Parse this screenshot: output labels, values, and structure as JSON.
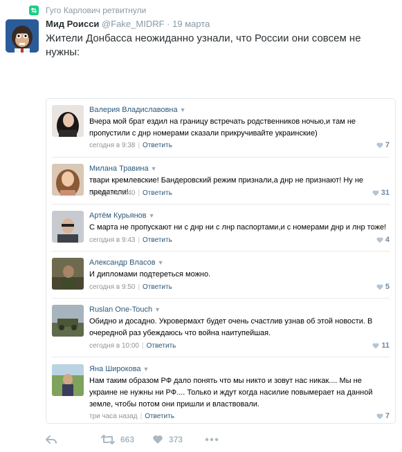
{
  "retweet": {
    "text": "Гуго Карлович ретвитнули"
  },
  "tweet": {
    "name": "Мид Роисси",
    "handle": "@Fake_MIDRF",
    "dot": "·",
    "date": "19 марта",
    "text": "Жители Донбасса неожиданно узнали, что России они совсем не нужны:"
  },
  "comments": [
    {
      "name": "Валерия Владиславовна",
      "text": "Вчера мой брат ездил на границу встречать родственников ночью,и там не пропустили с днр номерами сказали прикручивайте украинские)",
      "time": "сегодня в 9:38",
      "reply": "Ответить",
      "likes": "7"
    },
    {
      "name": "Милана Травина",
      "text": "твари кремлевские! Бандеровский режим признали,а днр не признают! Ну не предатели!",
      "time": "сегодня в 9:40",
      "reply": "Ответить",
      "likes": "31"
    },
    {
      "name": "Артём Курьянов",
      "text": "С марта не пропускают ни с днр ни с лнр паспортами,и с номерами днр и лнр тоже!",
      "time": "сегодня в 9:43",
      "reply": "Ответить",
      "likes": "4"
    },
    {
      "name": "Александр Власов",
      "text": "И дипломами подтереться можно.",
      "time": "сегодня в 9:50",
      "reply": "Ответить",
      "likes": "5"
    },
    {
      "name": "Ruslan One-Touch",
      "text": "Обидно и досадно. Укровермахт будет очень счастлив узнав об этой новости. В очередной раз убеждаюсь что война наитупейшая.",
      "time": "сегодня в 10:00",
      "reply": "Ответить",
      "likes": "11"
    },
    {
      "name": "Яна Широкова",
      "text": "Нам таким образом РФ дало понять что мы никто и зовут нас никак.... Мы не украине не нужны ни РФ.... Только и ждут когда насилие повымерает на данной земле, чтобы потом они пришли и властвовали.",
      "time": "три часа назад",
      "reply": "Ответить",
      "likes": "7"
    }
  ],
  "actions": {
    "retweets": "663",
    "likes": "373"
  }
}
